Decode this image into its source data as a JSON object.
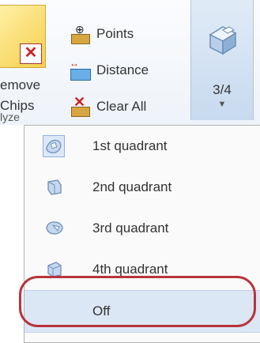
{
  "ribbon": {
    "remove_chips": {
      "label": "emove\nChips",
      "icon": "remove-chips-icon"
    },
    "commands": [
      {
        "label": "Points",
        "icon": "points-icon"
      },
      {
        "label": "Distance",
        "icon": "distance-icon"
      },
      {
        "label": "Clear All",
        "icon": "clear-all-icon"
      }
    ],
    "view_button": {
      "label": "3/4",
      "icon": "view-block-icon"
    },
    "group_label": "lyze"
  },
  "menu": {
    "items": [
      {
        "label": "1st quadrant",
        "icon": "quadrant-1-icon",
        "selected": true
      },
      {
        "label": "2nd quadrant",
        "icon": "quadrant-2-icon"
      },
      {
        "label": "3rd quadrant",
        "icon": "quadrant-3-icon"
      },
      {
        "label": "4th quadrant",
        "icon": "quadrant-4-icon"
      },
      {
        "label": "Off",
        "highlighted": true
      }
    ]
  },
  "colors": {
    "ribbon_bg": "#eef3f9",
    "selected_bg": "#dbe7f5",
    "highlight_ring": "#b8343d"
  }
}
